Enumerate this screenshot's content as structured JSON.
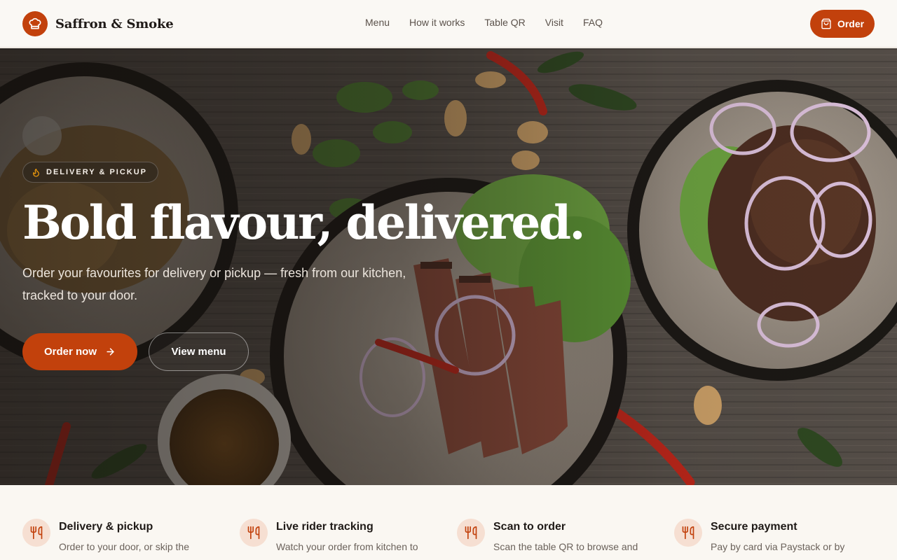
{
  "brand": {
    "name": "Saffron & Smoke"
  },
  "nav": {
    "items": [
      "Menu",
      "How it works",
      "Table QR",
      "Visit",
      "FAQ"
    ]
  },
  "header": {
    "order_label": "Order"
  },
  "hero": {
    "badge": "DELIVERY & PICKUP",
    "title": "Bold flavour, delivered.",
    "subtitle": "Order your favourites for delivery or pickup — fresh from our kitchen, tracked to your door.",
    "primary_cta": "Order now",
    "secondary_cta": "View menu"
  },
  "features": [
    {
      "title": "Delivery & pickup",
      "desc": "Order to your door, or skip the"
    },
    {
      "title": "Live rider tracking",
      "desc": "Watch your order from kitchen to"
    },
    {
      "title": "Scan to order",
      "desc": "Scan the table QR to browse and"
    },
    {
      "title": "Secure payment",
      "desc": "Pay by card via Paystack or by"
    }
  ],
  "colors": {
    "accent": "#c2410c",
    "background": "#faf7f2",
    "icon_bg": "#f6dfd2"
  },
  "icons": {
    "brand": "chef-hat-icon",
    "order": "shopping-bag-icon",
    "badge": "flame-icon",
    "cta": "arrow-right-icon",
    "feature": "utensils-icon"
  }
}
